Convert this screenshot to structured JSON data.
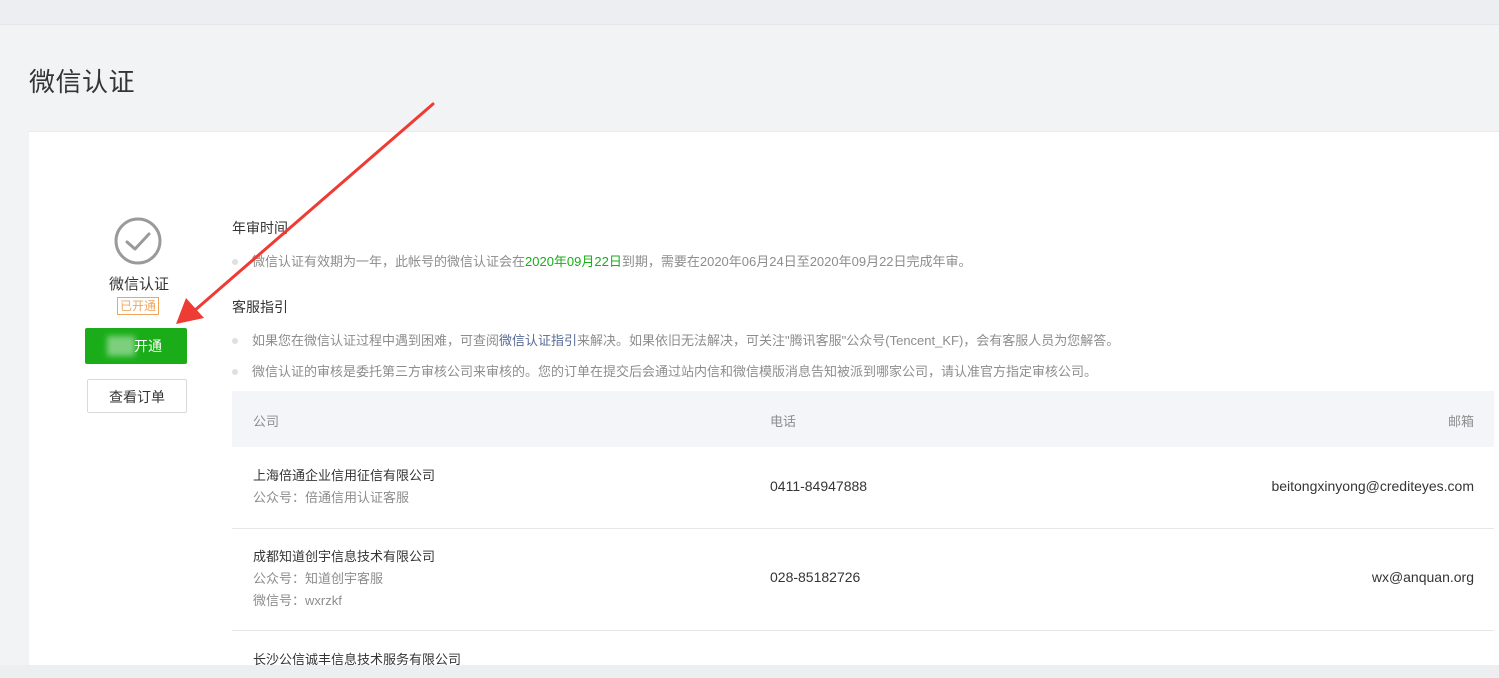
{
  "page": {
    "title": "微信认证"
  },
  "status": {
    "name": "微信认证",
    "badge": "已开通",
    "renew_button": "重新开通",
    "renew_button_visible_suffix": "开通",
    "orders_button": "查看订单"
  },
  "annual_review": {
    "title": "年审时间",
    "text_before": "微信认证有效期为一年，此帐号的微信认证会在",
    "expiry_date": "2020年09月22日",
    "text_after": "到期，需要在2020年06月24日至2020年09月22日完成年审。"
  },
  "service_guide": {
    "title": "客服指引",
    "item1_before": "如果您在微信认证过程中遇到困难，可查阅",
    "item1_link": "微信认证指引",
    "item1_after": "来解决。如果依旧无法解决，可关注\"腾讯客服\"公众号(Tencent_KF)，会有客服人员为您解答。",
    "item2": "微信认证的审核是委托第三方审核公司来审核的。您的订单在提交后会通过站内信和微信模版消息告知被派到哪家公司，请认准官方指定审核公司。"
  },
  "table": {
    "headers": {
      "company": "公司",
      "phone": "电话",
      "email": "邮箱"
    },
    "rows": [
      {
        "company": "上海倍通企业信用征信有限公司",
        "official_account": "公众号：倍通信用认证客服",
        "phone": "0411-84947888",
        "email": "beitongxinyong@crediteyes.com"
      },
      {
        "company": "成都知道创宇信息技术有限公司",
        "official_account": "公众号：知道创宇客服",
        "wechat_id": "微信号：wxrzkf",
        "phone": "028-85182726",
        "email": "wx@anquan.org"
      },
      {
        "company": "长沙公信诚丰信息技术服务有限公司"
      }
    ]
  },
  "colors": {
    "accent_green": "#1aad19",
    "badge_orange": "#f0a55d",
    "link_blue": "#576b95",
    "annotation_arrow": "#ee3b34"
  },
  "icons": {
    "status": "check-circle-icon"
  }
}
